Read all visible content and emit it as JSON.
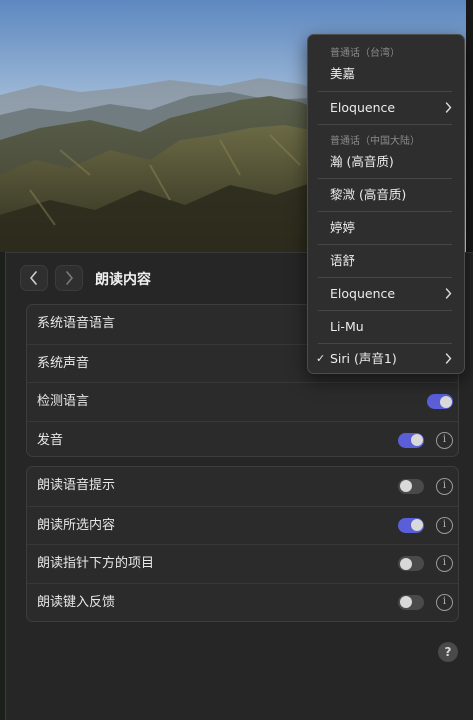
{
  "window": {
    "title": "朗读内容"
  },
  "group_1": {
    "rows": [
      {
        "label": "系统语音语言"
      },
      {
        "label": "系统声音"
      },
      {
        "label": "检测语言",
        "toggle": "on"
      },
      {
        "label": "发音",
        "toggle": "on",
        "info": "i"
      }
    ]
  },
  "group_2": {
    "rows": [
      {
        "label": "朗读语音提示",
        "toggle": "off",
        "info": "i"
      },
      {
        "label": "朗读所选内容",
        "toggle": "on",
        "info": "i"
      },
      {
        "label": "朗读指针下方的项目",
        "toggle": "off",
        "info": "i"
      },
      {
        "label": "朗读键入反馈",
        "toggle": "off",
        "info": "i"
      }
    ]
  },
  "help_label": "?",
  "voice_menu": {
    "header_1": "普通话（台湾）",
    "header_2": "普通话（中国大陆）",
    "items": [
      {
        "label": "美嘉"
      },
      {
        "label": "Eloquence",
        "submenu": true
      },
      {
        "label": "瀚 (高音质)"
      },
      {
        "label": "黎溦 (高音质)"
      },
      {
        "label": "婷婷"
      },
      {
        "label": "语舒"
      },
      {
        "label": "Eloquence",
        "submenu": true
      },
      {
        "label": "Li-Mu"
      },
      {
        "label": "Siri (声音1)",
        "submenu": true,
        "checked": true,
        "check": "✓"
      }
    ]
  },
  "colors": {
    "accent": "#5a5fd8",
    "toggle_off": "#4a4a4a",
    "menu_bg": "#2e2e2e",
    "window_bg": "#262626"
  },
  "icons": {
    "back": "chevron-left-icon",
    "forward": "chevron-right-icon",
    "info": "info-icon",
    "help": "help-icon",
    "submenu": "chevron-right-icon",
    "check": "checkmark-icon"
  }
}
